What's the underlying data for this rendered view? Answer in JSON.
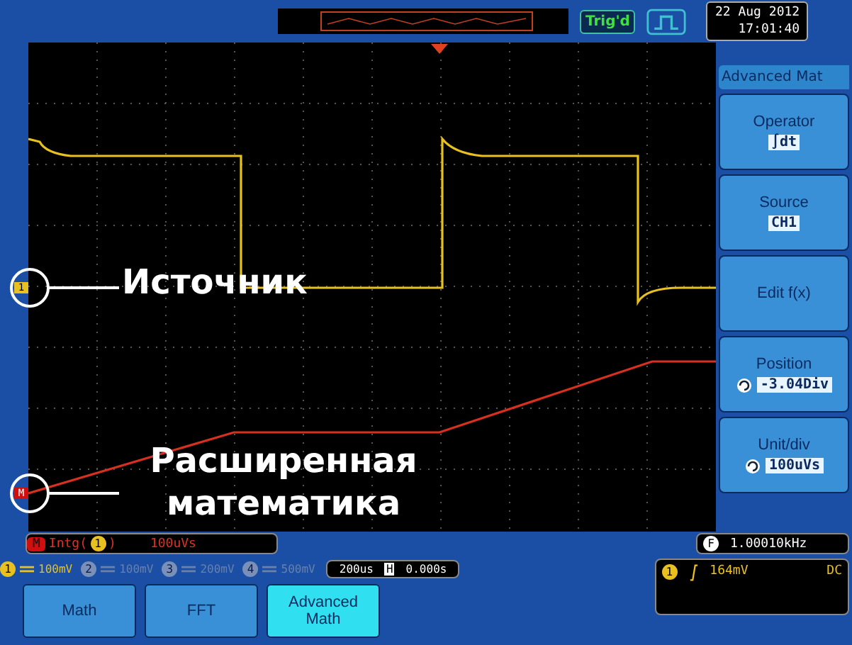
{
  "top_bar": {
    "trigger_status": "Trig'd",
    "date": "22 Aug 2012",
    "time": "17:01:40"
  },
  "markers": [
    {
      "label": "1",
      "color": "#e8c020"
    },
    {
      "label": "M",
      "color": "#d01010"
    }
  ],
  "annotations": [
    "Источник",
    "Расширенная математика"
  ],
  "side_menu": {
    "title": "Advanced Mat",
    "items": [
      {
        "label": "Operator",
        "value": "∫dt",
        "knob": false
      },
      {
        "label": "Source",
        "value": "CH1",
        "knob": false
      },
      {
        "label": "Edit f(x)"
      },
      {
        "label": "Position",
        "value": "-3.04Div",
        "knob": true
      },
      {
        "label": "Unit/div",
        "value": "100uVs",
        "knob": true
      }
    ]
  },
  "math_status": {
    "badge": "M",
    "function": "Intg(",
    "source": "1",
    "close": ")",
    "scale": "100uVs"
  },
  "frequency": {
    "badge": "F",
    "value": "1.00010kHz"
  },
  "channels": [
    {
      "number": "1",
      "scale": "100mV",
      "on": true
    },
    {
      "number": "2",
      "scale": "100mV",
      "on": false
    },
    {
      "number": "3",
      "scale": "200mV",
      "on": false
    },
    {
      "number": "4",
      "scale": "500mV",
      "on": false
    }
  ],
  "timebase": {
    "scale": "200us",
    "badge": "H",
    "position": "0.000s"
  },
  "trigger": {
    "source": "1",
    "level": "164mV",
    "coupling": "DC"
  },
  "softkeys": [
    {
      "label": "Math",
      "selected": false
    },
    {
      "label": "FFT",
      "selected": false
    },
    {
      "label": "Advanced Math",
      "selected": true
    }
  ]
}
